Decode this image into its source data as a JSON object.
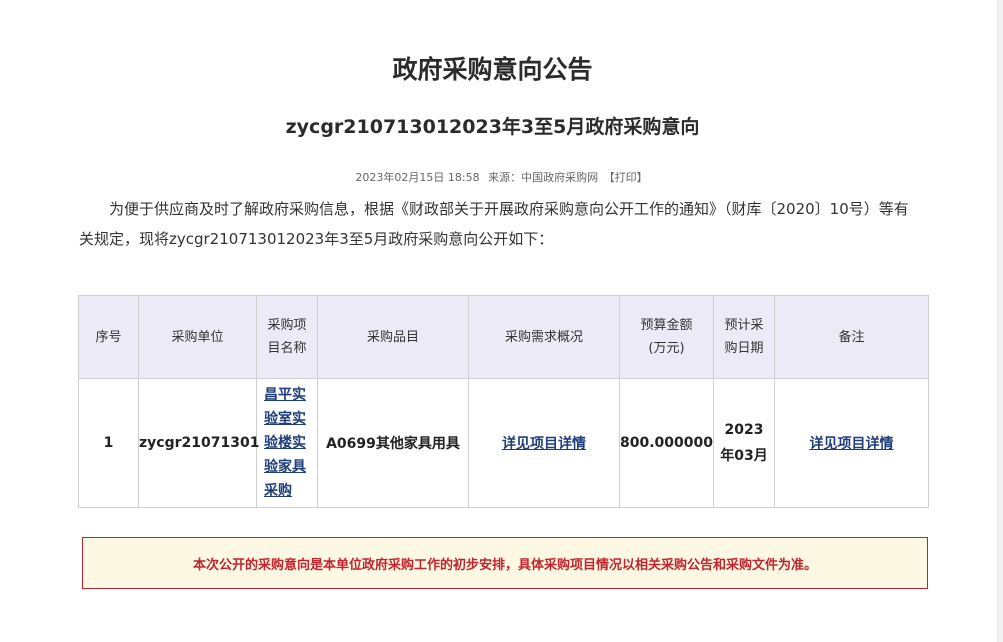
{
  "header": {
    "title": "政府采购意向公告",
    "subtitle": "zycgr210713012023年3至5月政府采购意向"
  },
  "meta": {
    "datetime": "2023年02月15日 18:58",
    "source_label": "来源：",
    "source": "中国政府采购网",
    "print_label": "【打印】"
  },
  "intro": "为便于供应商及时了解政府采购信息，根据《财政部关于开展政府采购意向公开工作的通知》（财库〔2020〕10号）等有关规定，现将zycgr210713012023年3至5月政府采购意向公开如下：",
  "table": {
    "headers": {
      "seq": "序号",
      "unit": "采购单位",
      "project_name": "采购项目名称",
      "item": "采购品目",
      "demand": "采购需求概况",
      "budget": "预算金额(万元)",
      "date": "预计采购日期",
      "note": "备注"
    },
    "rows": [
      {
        "seq": "1",
        "unit": "zycgr21071301",
        "project_name": "昌平实验室实验楼实验家具采购",
        "item": "A0699其他家具用具",
        "demand": "详见项目详情",
        "budget": "800.000000",
        "date": "2023年03月",
        "note": "详见项目详情"
      }
    ]
  },
  "notice": "本次公开的采购意向是本单位政府采购工作的初步安排，具体采购项目情况以相关采购公告和采购文件为准。"
}
